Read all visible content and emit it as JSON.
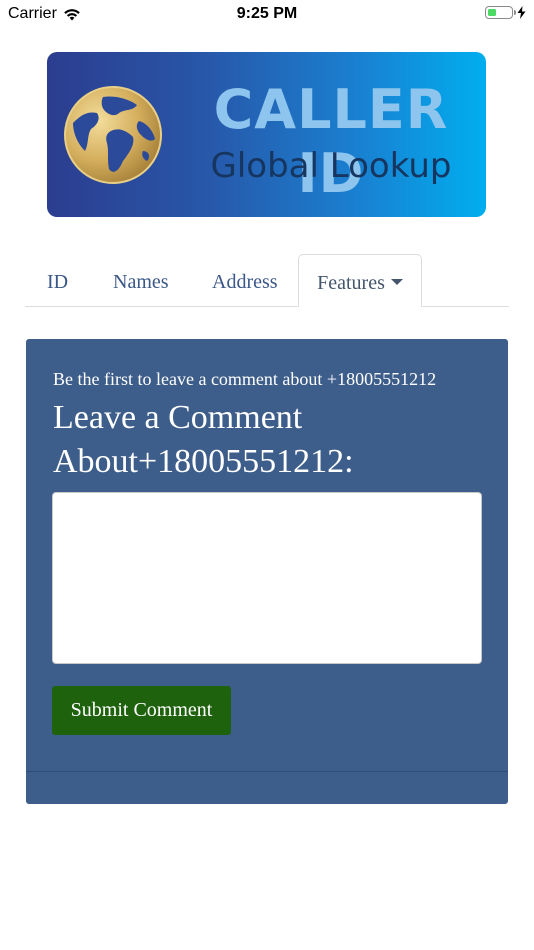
{
  "status_bar": {
    "carrier": "Carrier",
    "time": "9:25 PM",
    "battery_level": 0.4,
    "wifi_icon": "wifi-icon",
    "charging_icon": "bolt-icon"
  },
  "banner": {
    "title": "CALLER ID",
    "subtitle": "Global Lookup",
    "icon": "globe-icon",
    "colors": {
      "title": "#8ec5ee",
      "subtitle": "#16355f",
      "gradient_start": "#2c3d8f",
      "gradient_end": "#00aeef"
    }
  },
  "tabs": [
    {
      "label": "ID"
    },
    {
      "label": "Names"
    },
    {
      "label": "Address"
    },
    {
      "label": "Features",
      "active": true,
      "dropdown": true
    }
  ],
  "comment_card": {
    "note": "Be the first to leave a comment about +18005551212",
    "heading": "Leave a Comment About+18005551212:",
    "textarea_value": "",
    "submit_label": "Submit Comment",
    "colors": {
      "card_bg": "#3d5d8a",
      "button_bg": "#1f620e"
    }
  }
}
